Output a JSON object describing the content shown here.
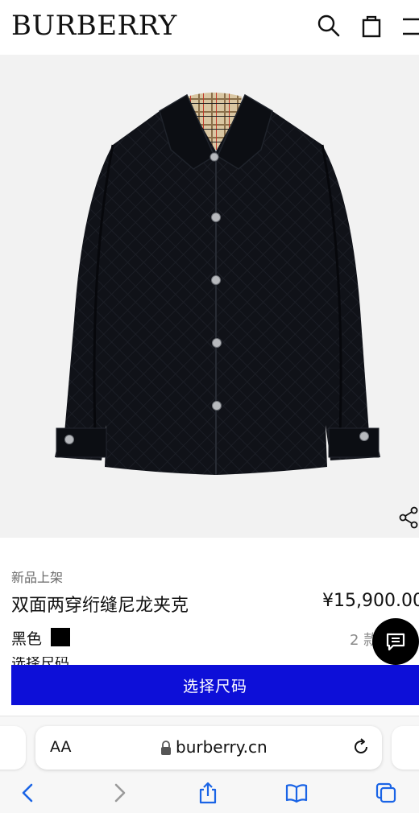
{
  "header": {
    "logo": "BURBERRY",
    "icons": [
      "search-icon",
      "shopping-bag-icon",
      "menu-icon"
    ]
  },
  "product": {
    "badge": "新品上架",
    "title": "双面两穿绗缝尼龙夹克",
    "price": "¥15,900.00",
    "color_label": "黑色",
    "swatch_color": "#000000",
    "variants": "2 款",
    "size_peek": "选择尺码",
    "select_size_button": "选择尺码",
    "button_color": "#0d0fd8"
  },
  "browser": {
    "text_size": "AA",
    "url": "burberry.cn",
    "icons": [
      "lock-icon",
      "reload-icon",
      "back-icon",
      "forward-icon",
      "share-icon",
      "bookmarks-icon",
      "tabs-icon"
    ]
  }
}
